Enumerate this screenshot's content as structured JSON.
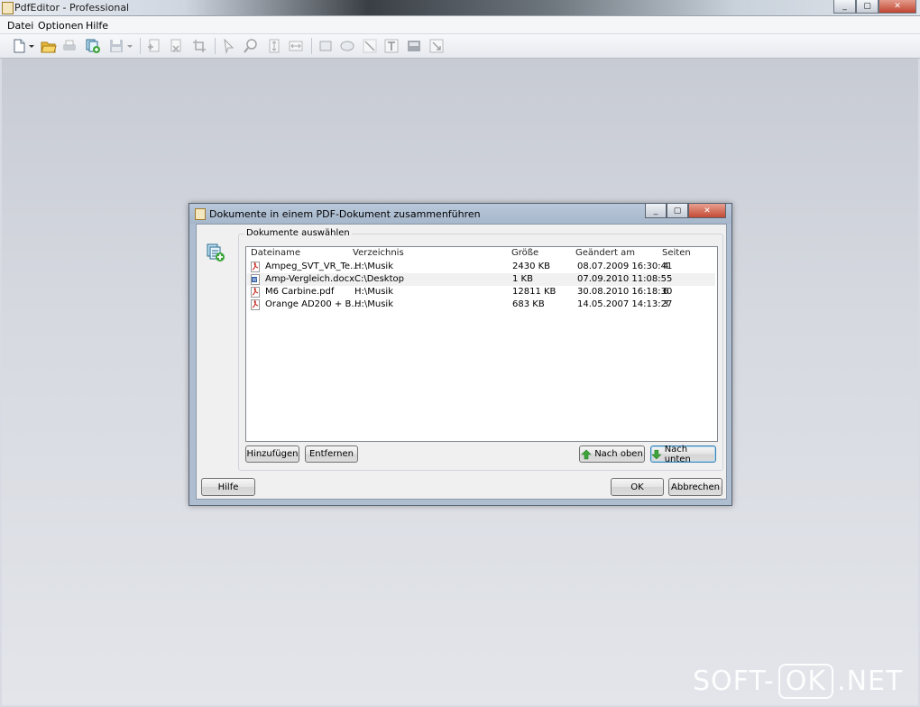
{
  "window": {
    "title": "PdfEditor - Professional",
    "controls": [
      "_",
      "▢",
      "✕"
    ]
  },
  "menubar": {
    "items": [
      {
        "label": "Datei"
      },
      {
        "label": "Optionen"
      },
      {
        "label": "Hilfe"
      }
    ]
  },
  "toolbar": {
    "icons": [
      "new-doc-icon",
      "open-folder-icon",
      "print-icon",
      "merge-icon",
      "save-icon",
      "insert-page-icon",
      "delete-page-icon",
      "crop-icon",
      "select-arrow-icon",
      "zoom-icon",
      "fit-height-icon",
      "fit-width-icon",
      "rectangle-icon",
      "ellipse-icon",
      "line-icon",
      "text-icon",
      "image-icon",
      "link-icon"
    ]
  },
  "dialog": {
    "title": "Dokumente in einem PDF-Dokument zusammenführen",
    "group_label": "Dokumente auswählen",
    "columns": [
      "Dateiname",
      "Verzeichnis",
      "Größe",
      "Geändert am",
      "Seiten"
    ],
    "rows": [
      {
        "type": "pdf",
        "name": "Ampeg_SVT_VR_Te...",
        "dir": "H:\\Musik",
        "size": "2430 KB",
        "date": "08.07.2009 16:30:41",
        "pages": "4"
      },
      {
        "type": "doc",
        "name": "Amp-Vergleich.docx",
        "dir": "C:\\Desktop",
        "size": "1 KB",
        "date": "07.09.2010 11:08:55",
        "pages": ""
      },
      {
        "type": "pdf",
        "name": "M6 Carbine.pdf",
        "dir": "H:\\Musik",
        "size": "12811 KB",
        "date": "30.08.2010 16:18:30",
        "pages": "6"
      },
      {
        "type": "pdf",
        "name": "Orange AD200 + B...",
        "dir": "H:\\Musik",
        "size": "683 KB",
        "date": "14.05.2007 14:13:27",
        "pages": "3"
      }
    ],
    "buttons": {
      "add": "Hinzufügen",
      "remove": "Entfernen",
      "up": "Nach oben",
      "down": "Nach unten",
      "help": "Hilfe",
      "ok": "OK",
      "cancel": "Abbrechen"
    }
  },
  "watermark": {
    "left": "SOFT-",
    "box": "OK",
    "right": ".NET"
  },
  "colors": {
    "arrow_green": "#3ea53a",
    "pdf_red": "#c8281e",
    "word_blue": "#2a5aa8"
  }
}
